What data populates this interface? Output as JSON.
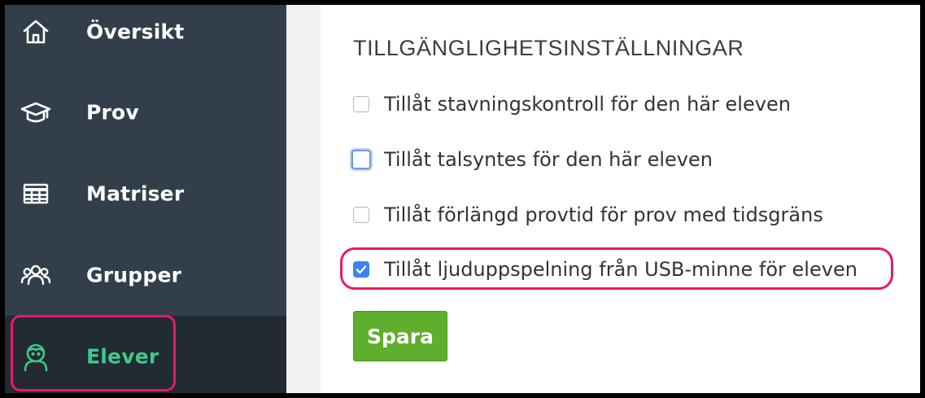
{
  "sidebar": {
    "items": [
      {
        "label": "Översikt",
        "icon": "home-icon"
      },
      {
        "label": "Prov",
        "icon": "graduation-cap-icon"
      },
      {
        "label": "Matriser",
        "icon": "table-grid-icon"
      },
      {
        "label": "Grupper",
        "icon": "group-icon"
      },
      {
        "label": "Elever",
        "icon": "student-icon",
        "active": true
      }
    ]
  },
  "settings": {
    "title": "TILLGÄNGLIGHETSINSTÄLLNINGAR",
    "options": [
      {
        "label": "Tillåt stavningskontroll för den här eleven",
        "checked": false
      },
      {
        "label": "Tillåt talsyntes för den här eleven",
        "checked": false,
        "focused": true
      },
      {
        "label": "Tillåt förlängd provtid för prov med tidsgräns",
        "checked": false
      },
      {
        "label": "Tillåt ljuduppspelning från USB-minne för eleven",
        "checked": true
      }
    ],
    "save_label": "Spara"
  },
  "colors": {
    "sidebar_bg": "#333e4b",
    "active_bg": "#222a33",
    "active_text": "#3ec98a",
    "highlight": "#e8196a",
    "save_button": "#5fae2e",
    "checkbox_checked": "#3b83f0"
  }
}
